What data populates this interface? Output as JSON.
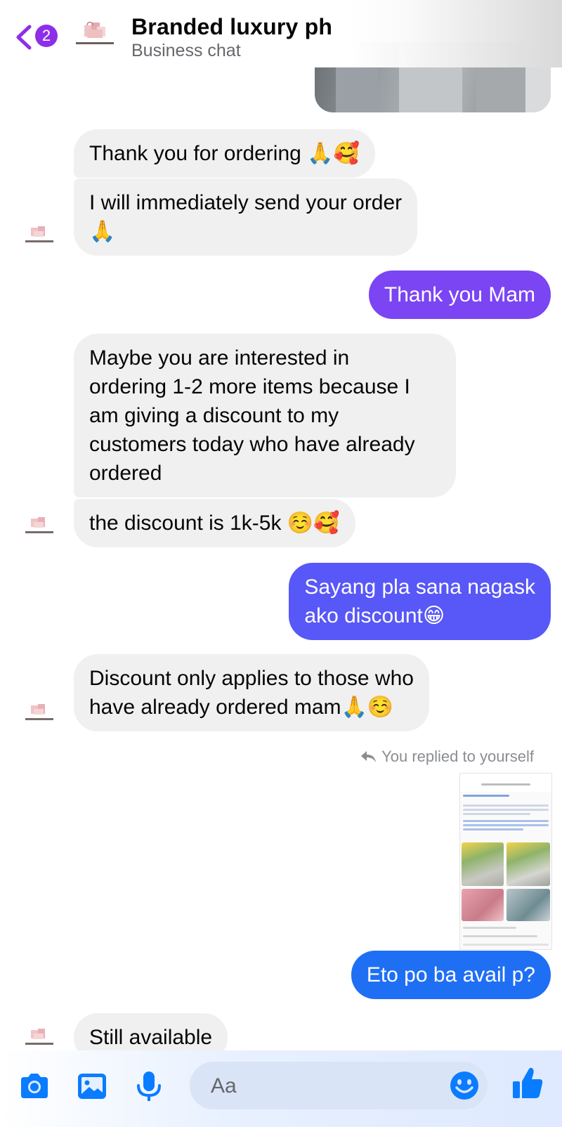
{
  "header": {
    "unread_count": "2",
    "title": "Branded luxury ph",
    "subtitle": "Business chat"
  },
  "messages": [
    {
      "dir": "in",
      "text": "Thank you for ordering 🙏🥰"
    },
    {
      "dir": "in",
      "text": "I will immediately send your order\n🙏"
    },
    {
      "dir": "out",
      "text": "Thank you Mam",
      "color": "#7b45f3"
    },
    {
      "dir": "in",
      "text": "Maybe you are interested in\nordering 1-2 more items because I\nam giving a discount to my\ncustomers today who have already\nordered"
    },
    {
      "dir": "in",
      "text": "the discount is 1k-5k ☺️🥰"
    },
    {
      "dir": "out",
      "text": "Sayang pla sana nagask\nako discount😁",
      "color": "#5857f7"
    },
    {
      "dir": "in",
      "text": "Discount only applies to those who\nhave already ordered mam🙏☺️"
    },
    {
      "dir": "out",
      "text": "Eto po ba avail p?",
      "color": "#1f6ff5"
    },
    {
      "dir": "in",
      "text": "Still available"
    }
  ],
  "reply_label": "You replied to yourself",
  "composer": {
    "placeholder": "Aa"
  },
  "icons": {
    "back": "chevron-left-icon",
    "camera": "camera-icon",
    "gallery": "photo-icon",
    "mic": "microphone-icon",
    "emoji": "smiley-icon",
    "like": "thumbs-up-icon"
  },
  "colors": {
    "accent": "#8f2ee8",
    "incoming_bubble": "#f0f0f0",
    "composer_icon": "#0a7cff"
  }
}
